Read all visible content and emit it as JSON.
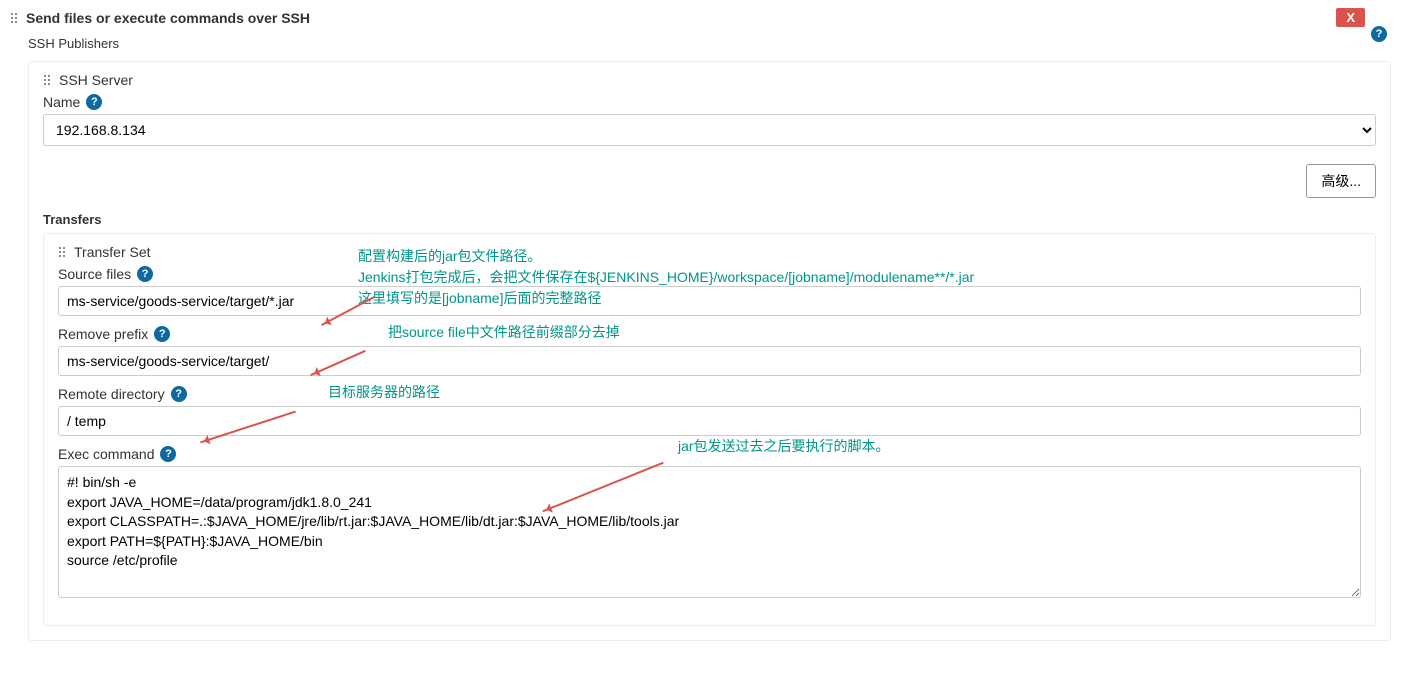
{
  "header": {
    "title": "Send files or execute commands over SSH",
    "close_label": "X"
  },
  "publishers_label": "SSH Publishers",
  "server": {
    "section_label": "SSH Server",
    "name_label": "Name",
    "name_value": "192.168.8.134",
    "advanced_label": "高级..."
  },
  "transfers": {
    "section_label": "Transfers",
    "set_label": "Transfer Set",
    "source_files": {
      "label": "Source files",
      "value": "ms-service/goods-service/target/*.jar",
      "annotation": "配置构建后的jar包文件路径。\nJenkins打包完成后，会把文件保存在${JENKINS_HOME}/workspace/[jobname]/modulename**/*.jar\n这里填写的是[jobname]后面的完整路径"
    },
    "remove_prefix": {
      "label": "Remove prefix",
      "value": "ms-service/goods-service/target/",
      "annotation": "把source file中文件路径前缀部分去掉"
    },
    "remote_directory": {
      "label": "Remote directory",
      "value": "/ temp",
      "annotation": "目标服务器的路径"
    },
    "exec_command": {
      "label": "Exec command",
      "value": "#! bin/sh -e\nexport JAVA_HOME=/data/program/jdk1.8.0_241\nexport CLASSPATH=.:$JAVA_HOME/jre/lib/rt.jar:$JAVA_HOME/lib/dt.jar:$JAVA_HOME/lib/tools.jar\nexport PATH=${PATH}:$JAVA_HOME/bin\nsource /etc/profile",
      "annotation": "jar包发送过去之后要执行的脚本。"
    }
  }
}
